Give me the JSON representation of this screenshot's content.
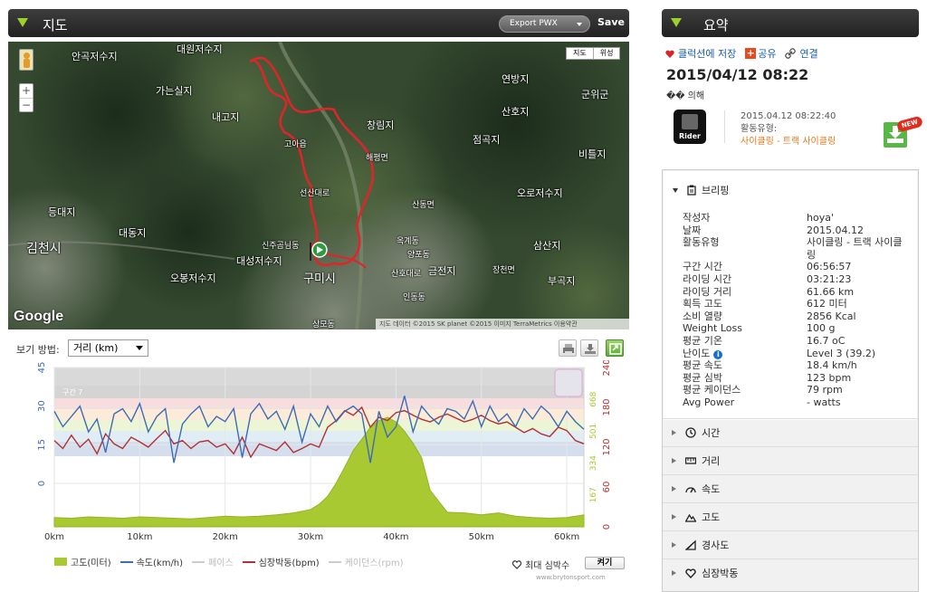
{
  "map_panel": {
    "title": "지도",
    "export_label": "Export PWX",
    "save_label": "Save",
    "map_type": [
      "지도",
      "위성"
    ],
    "places": [
      {
        "name": "대원저수지",
        "big": true
      },
      {
        "name": "안곡저수지",
        "big": true
      },
      {
        "name": "가는실지",
        "big": true
      },
      {
        "name": "내고지",
        "big": true
      },
      {
        "name": "창림지",
        "big": true
      },
      {
        "name": "연방지",
        "big": true
      },
      {
        "name": "산호지",
        "big": true
      },
      {
        "name": "군위군",
        "big": true
      },
      {
        "name": "점곡지",
        "big": true
      },
      {
        "name": "비틀지",
        "big": true
      },
      {
        "name": "오로저수지",
        "big": true
      },
      {
        "name": "등대지",
        "big": true
      },
      {
        "name": "대동지",
        "big": true
      },
      {
        "name": "김천시",
        "big": true
      },
      {
        "name": "대성저수지",
        "big": true
      },
      {
        "name": "오봉저수지",
        "big": true
      },
      {
        "name": "구미시",
        "big": true
      },
      {
        "name": "금전지",
        "big": true
      },
      {
        "name": "삼산지",
        "big": true
      },
      {
        "name": "부곡지",
        "big": true
      },
      {
        "name": "신주곰님동",
        "big": false
      },
      {
        "name": "선산대로",
        "big": false
      },
      {
        "name": "해평면",
        "big": false
      },
      {
        "name": "산동면",
        "big": false
      },
      {
        "name": "인동동",
        "big": false
      },
      {
        "name": "장천면",
        "big": false
      },
      {
        "name": "상모동",
        "big": false
      },
      {
        "name": "옥계동",
        "big": false
      },
      {
        "name": "양포동",
        "big": false
      },
      {
        "name": "산호대로",
        "big": false
      },
      {
        "name": "고아읍",
        "big": false
      }
    ],
    "google": "Google",
    "attribution": "지도 데이터 ©2015 SK planet ©2015 이미지 TerraMetrics  이용약관"
  },
  "chart_controls": {
    "view_label": "보기 방법:",
    "view_value": "거리 (km)"
  },
  "chart_data": {
    "type": "line",
    "x_unit": "km",
    "x_ticks": [
      "0km",
      "10km",
      "20km",
      "30km",
      "40km",
      "50km",
      "60km"
    ],
    "xlim": [
      0,
      62
    ],
    "left_axis_ticks": [
      "45",
      "30",
      "15",
      "0"
    ],
    "hr_axis_ticks": [
      "240",
      "180",
      "120",
      "60",
      "0"
    ],
    "speed_axis_ticks": [
      "668",
      "501",
      "334",
      "167"
    ],
    "zone_label": "구간 7",
    "series": [
      {
        "name": "고도(미터)",
        "color": "#a8c932",
        "x": [
          0,
          2,
          4,
          6,
          8,
          10,
          12,
          14,
          16,
          18,
          20,
          22,
          24,
          26,
          28,
          30,
          31,
          32,
          33,
          34,
          35,
          36,
          37,
          38,
          39,
          40,
          41,
          42,
          43,
          44,
          46,
          48,
          50,
          52,
          54,
          56,
          58,
          60,
          62
        ],
        "values": [
          14,
          13,
          15,
          14,
          13,
          15,
          14,
          13,
          12,
          14,
          16,
          15,
          16,
          18,
          21,
          26,
          34,
          46,
          66,
          90,
          115,
          132,
          150,
          160,
          165,
          158,
          144,
          126,
          104,
          55,
          22,
          21,
          18,
          21,
          16,
          14,
          13,
          14,
          18
        ]
      },
      {
        "name": "속도(km/h)",
        "color": "#3d6cb4",
        "x": [
          0,
          1,
          2,
          3,
          4,
          5,
          6,
          7,
          8,
          9,
          10,
          11,
          12,
          13,
          14,
          15,
          16,
          17,
          18,
          19,
          20,
          21,
          22,
          23,
          24,
          25,
          26,
          27,
          28,
          29,
          30,
          31,
          32,
          33,
          34,
          35,
          36,
          37,
          38,
          39,
          40,
          41,
          42,
          43,
          44,
          45,
          46,
          47,
          48,
          49,
          50,
          51,
          52,
          53,
          54,
          55,
          56,
          57,
          58,
          59,
          60,
          61,
          62
        ],
        "values": [
          28,
          22,
          26,
          30,
          20,
          25,
          12,
          27,
          29,
          24,
          31,
          20,
          26,
          29,
          8,
          23,
          27,
          30,
          22,
          26,
          24,
          29,
          10,
          27,
          31,
          25,
          28,
          21,
          30,
          16,
          27,
          22,
          30,
          24,
          28,
          30,
          27,
          8,
          28,
          18,
          22,
          34,
          20,
          30,
          26,
          23,
          29,
          28,
          25,
          32,
          22,
          30,
          24,
          27,
          22,
          29,
          25,
          30,
          27,
          22,
          28,
          24,
          21
        ]
      },
      {
        "name": "심장박동(bpm)",
        "color": "#b03234",
        "x": [
          0,
          1,
          2,
          3,
          4,
          5,
          6,
          7,
          8,
          9,
          10,
          11,
          12,
          13,
          14,
          15,
          16,
          17,
          18,
          19,
          20,
          21,
          22,
          23,
          24,
          25,
          26,
          27,
          28,
          29,
          30,
          31,
          32,
          33,
          34,
          35,
          36,
          37,
          38,
          39,
          40,
          41,
          42,
          43,
          44,
          45,
          46,
          47,
          48,
          49,
          50,
          51,
          52,
          53,
          54,
          55,
          56,
          57,
          58,
          59,
          60,
          61,
          62
        ],
        "values": [
          130,
          118,
          138,
          120,
          132,
          110,
          140,
          125,
          118,
          135,
          128,
          120,
          133,
          145,
          125,
          130,
          118,
          128,
          130,
          120,
          125,
          110,
          135,
          105,
          125,
          120,
          115,
          128,
          112,
          118,
          125,
          120,
          150,
          160,
          175,
          168,
          180,
          150,
          165,
          160,
          172,
          175,
          168,
          162,
          158,
          165,
          170,
          164,
          158,
          162,
          168,
          160,
          155,
          158,
          150,
          142,
          148,
          140,
          136,
          150,
          145,
          130,
          125
        ]
      }
    ],
    "legend": [
      {
        "label": "고도(미터)",
        "color": "#a8c932",
        "kind": "area",
        "active": true
      },
      {
        "label": "속도(km/h)",
        "color": "#3d6cb4",
        "kind": "line",
        "active": true
      },
      {
        "label": "페이스",
        "color": "#cccccc",
        "kind": "line",
        "active": false
      },
      {
        "label": "심장박동(bpm)",
        "color": "#b03234",
        "kind": "line",
        "active": true
      },
      {
        "label": "케이던스(rpm)",
        "color": "#cccccc",
        "kind": "line",
        "active": false
      }
    ]
  },
  "chart_footer": {
    "max_hr_label": "최대 심박수",
    "toggle_label": "켜기",
    "credit": "www.brytonsport.com"
  },
  "summary": {
    "title": "요약",
    "save_collection": "클럭션에 저장",
    "share": "공유",
    "link": "연결",
    "datetime": "2015/04/12 08:22",
    "name": "�� 의해",
    "device": "Rider",
    "meta_datetime": "2015.04.12 08:22:40",
    "activity_type_label": "활동유형:",
    "activity_type": "사이클링 - 트랙 사이클링",
    "new_badge": "NEW",
    "briefing_title": "브리핑",
    "stats": [
      {
        "k": "작성자",
        "v": "hoya'"
      },
      {
        "k": "날짜",
        "v": "2015.04.12"
      },
      {
        "k": "활동유형",
        "v": "사이클링 - 트랙 사이클"
      },
      {
        "k": "",
        "v": "링"
      },
      {
        "k": "구간 시간",
        "v": "06:56:57"
      },
      {
        "k": "라이딩 시간",
        "v": "03:21:23"
      },
      {
        "k": "라이딩 거리",
        "v": "61.66 km"
      },
      {
        "k": "획득 고도",
        "v": "612 미터"
      },
      {
        "k": "소비 열량",
        "v": "2856 Kcal"
      },
      {
        "k": "Weight Loss",
        "v": "100 g"
      },
      {
        "k": "평균 기온",
        "v": "16.7 oC"
      },
      {
        "k": "난이도",
        "v": "Level 3 (39.2)",
        "info": true
      },
      {
        "k": "평균 속도",
        "v": "18.4 km/h"
      },
      {
        "k": "평균 심박",
        "v": "123 bpm"
      },
      {
        "k": "평균 케이던스",
        "v": "79 rpm"
      },
      {
        "k": "Avg Power",
        "v": "- watts"
      }
    ],
    "sections": [
      {
        "label": "시간",
        "icon": "clock-icon"
      },
      {
        "label": "거리",
        "icon": "ruler-icon"
      },
      {
        "label": "속도",
        "icon": "speed-icon"
      },
      {
        "label": "고도",
        "icon": "mountain-icon"
      },
      {
        "label": "경사도",
        "icon": "slope-icon"
      },
      {
        "label": "심장박동",
        "icon": "heart-icon"
      }
    ]
  }
}
